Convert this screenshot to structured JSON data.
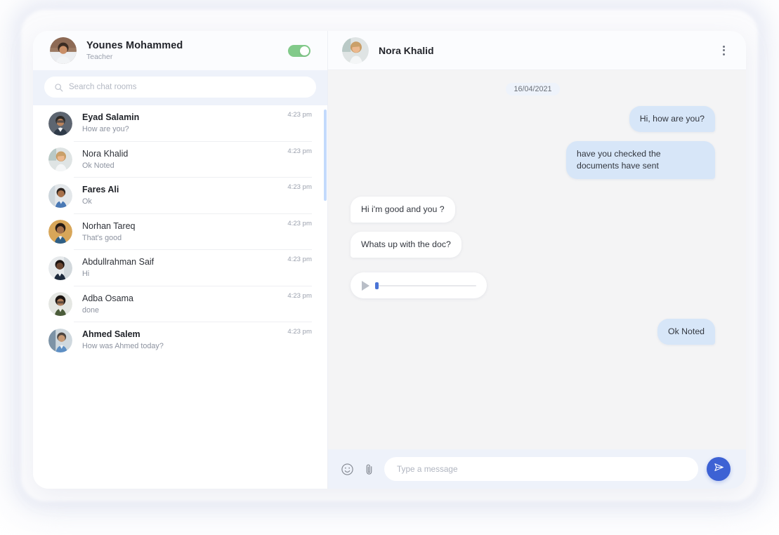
{
  "profile": {
    "name": "Younes Mohammed",
    "role": "Teacher",
    "avatar_icon": "user-avatar-younes",
    "toggle_icon": "status-toggle",
    "toggle_state": "on",
    "toggle_color": "#82ca8a"
  },
  "search": {
    "placeholder": "Search chat rooms",
    "value": "",
    "icon": "search-icon"
  },
  "chat_list": [
    {
      "name": "Eyad Salamin",
      "preview": "How are you?",
      "time": "4:23 pm",
      "unread": true,
      "avatar_icon": "user-avatar-eyad"
    },
    {
      "name": "Nora Khalid",
      "preview": "Ok Noted",
      "time": "4:23 pm",
      "unread": false,
      "avatar_icon": "user-avatar-nora"
    },
    {
      "name": "Fares Ali",
      "preview": "Ok",
      "time": "4:23 pm",
      "unread": true,
      "avatar_icon": "user-avatar-fares"
    },
    {
      "name": "Norhan Tareq",
      "preview": "That's good",
      "time": "4:23 pm",
      "unread": false,
      "avatar_icon": "user-avatar-norhan"
    },
    {
      "name": "Abdullrahman Saif",
      "preview": "Hi",
      "time": "4:23 pm",
      "unread": false,
      "avatar_icon": "user-avatar-abdullrahman"
    },
    {
      "name": "Adba Osama",
      "preview": "done",
      "time": "4:23 pm",
      "unread": false,
      "avatar_icon": "user-avatar-adba"
    },
    {
      "name": "Ahmed Salem",
      "preview": "How was Ahmed today?",
      "time": "4:23 pm",
      "unread": true,
      "avatar_icon": "user-avatar-ahmed"
    }
  ],
  "conversation": {
    "contact_name": "Nora Khalid",
    "contact_avatar_icon": "user-avatar-nora",
    "menu_icon": "kebab-menu-icon",
    "date_divider": "16/04/2021",
    "messages": [
      {
        "kind": "text",
        "direction": "out",
        "text": "Hi, how are you?"
      },
      {
        "kind": "text",
        "direction": "out",
        "text": "have you checked the documents have sent"
      },
      {
        "kind": "text",
        "direction": "in",
        "text": "Hi i'm good and you ?"
      },
      {
        "kind": "text",
        "direction": "in",
        "text": "Whats up with the doc?"
      },
      {
        "kind": "voice",
        "direction": "in",
        "text": "",
        "progress": 0
      },
      {
        "kind": "text",
        "direction": "out",
        "text": "Ok Noted"
      }
    ]
  },
  "composer": {
    "emoji_icon": "emoji-smiley-icon",
    "attach_icon": "paperclip-icon",
    "placeholder": "Type a message",
    "value": "",
    "send_icon": "send-paper-plane-icon",
    "send_color": "#3d62d4"
  },
  "colors": {
    "outgoing_bubble": "#d7e6f8",
    "incoming_bubble": "#ffffff",
    "chat_background": "#f4f4f5",
    "band_background": "#eef2fa",
    "scrollbar_thumb": "#c3dafc"
  }
}
